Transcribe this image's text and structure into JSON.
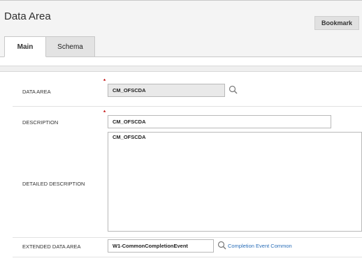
{
  "header": {
    "title": "Data Area",
    "bookmark_label": "Bookmark"
  },
  "tabs": [
    {
      "label": "Main",
      "active": true
    },
    {
      "label": "Schema",
      "active": false
    }
  ],
  "form": {
    "data_area": {
      "label": "DATA AREA",
      "value": "CM_OFSCDA",
      "required": true
    },
    "description": {
      "label": "DESCRIPTION",
      "value": "CM_OFSCDA",
      "required": true
    },
    "detailed_description": {
      "label": "DETAILED DESCRIPTION",
      "value": "CM_OFSCDA"
    },
    "extended_data_area": {
      "label": "EXTENDED DATA AREA",
      "value": "W1-CommonCompletionEvent",
      "link": "Completion Event Common"
    }
  },
  "colors": {
    "link": "#2a6eb8",
    "required_marker": "#c00000",
    "readonly_field": "#e9e9e9",
    "header_bg": "#f4f4f4"
  },
  "icons": [
    "search-icon"
  ]
}
